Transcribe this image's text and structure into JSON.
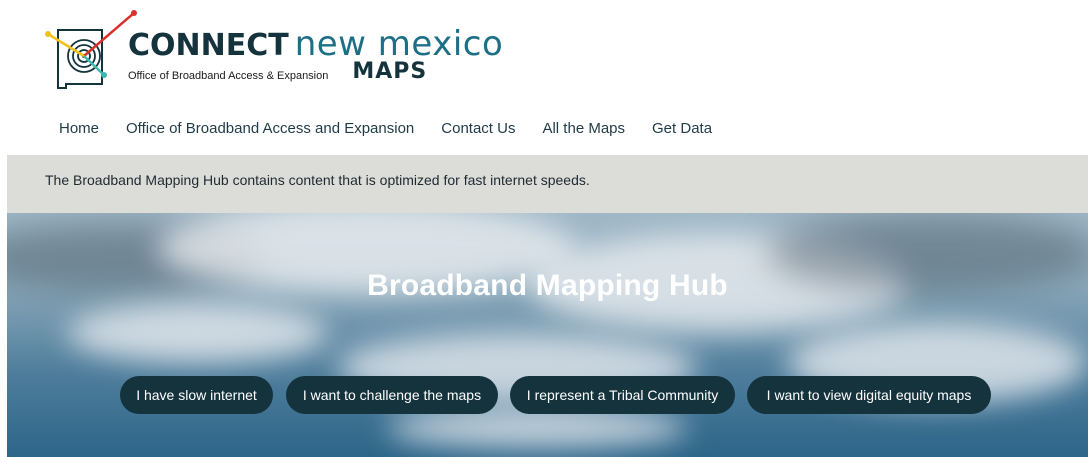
{
  "logo": {
    "brand_bold": "CONNECT",
    "brand_light": "new mexico",
    "office": "Office of Broadband Access & Expansion",
    "product": "MAPS"
  },
  "nav": {
    "items": [
      {
        "label": "Home"
      },
      {
        "label": "Office of Broadband Access and Expansion"
      },
      {
        "label": "Contact Us"
      },
      {
        "label": "All the Maps"
      },
      {
        "label": "Get Data"
      }
    ]
  },
  "banner": {
    "text": "The Broadband Mapping Hub contains content that is optimized for fast internet speeds."
  },
  "hero": {
    "title": "Broadband Mapping Hub",
    "buttons": [
      {
        "label": "I have slow internet"
      },
      {
        "label": "I want to challenge the maps"
      },
      {
        "label": "I represent a Tribal Community"
      },
      {
        "label": "I want to view digital equity maps"
      }
    ]
  },
  "colors": {
    "brand_dark": "#14333d",
    "brand_teal": "#1d6f86",
    "banner_bg": "#dcdcd9",
    "logo_red": "#d9312b",
    "logo_yellow": "#f2c21a",
    "logo_teal": "#3fb8b0"
  },
  "icons": [
    "new-mexico-signal-logo-icon"
  ]
}
